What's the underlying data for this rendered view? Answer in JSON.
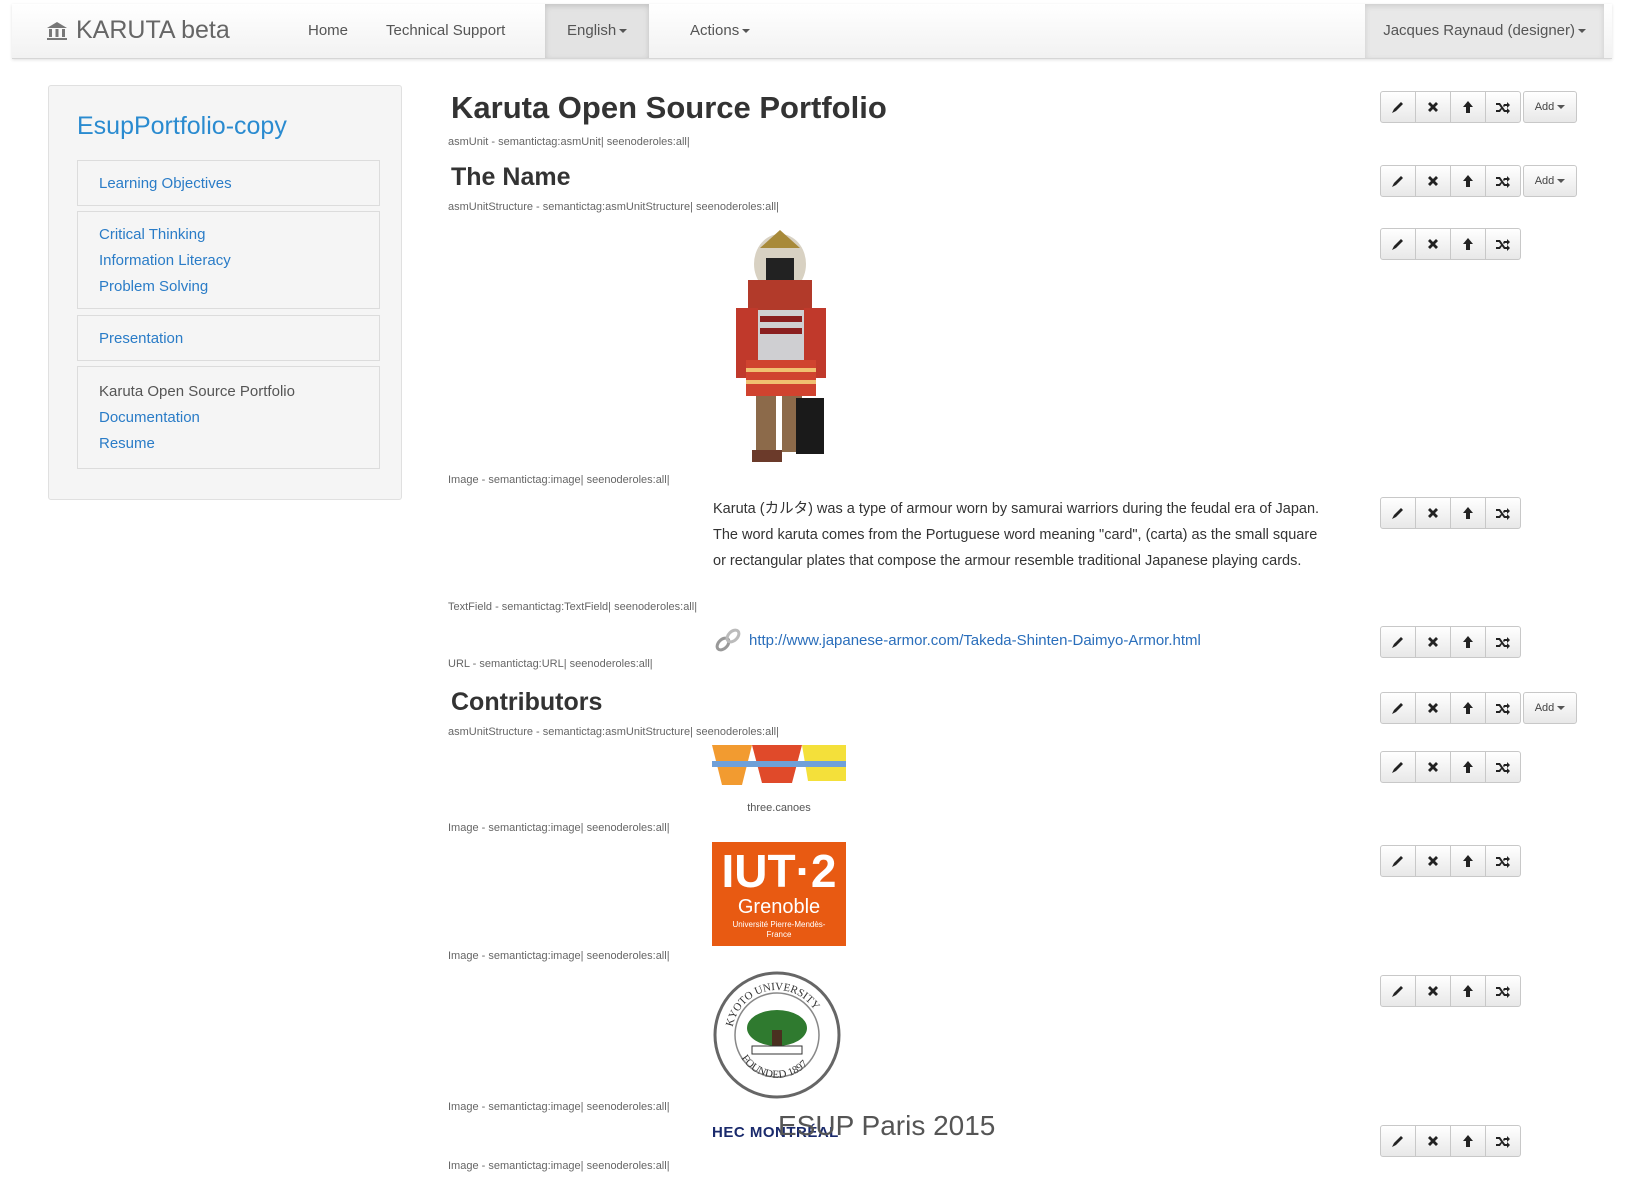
{
  "navbar": {
    "brand": "KARUTA beta",
    "items": [
      {
        "label": "Home"
      },
      {
        "label": "Technical Support"
      },
      {
        "label": "English"
      },
      {
        "label": "Actions"
      }
    ],
    "user": "Jacques Raynaud (designer)"
  },
  "sidebar": {
    "title": "EsupPortfolio-copy",
    "groups": [
      [
        "Learning Objectives"
      ],
      [
        "Critical Thinking",
        "Information Literacy",
        "Problem Solving"
      ],
      [
        "Presentation"
      ],
      [
        "Karuta Open Source Portfolio",
        "Documentation",
        "Resume"
      ]
    ]
  },
  "main": {
    "unit_title": "Karuta Open Source Portfolio",
    "unit_meta": "asmUnit - semantictag:asmUnit| seenoderoles:all|",
    "section1_title": "The Name",
    "section1_meta": "asmUnitStructure - semantictag:asmUnitStructure| seenoderoles:all|",
    "image_meta": "Image - semantictag:image| seenoderoles:all|",
    "text_body": "Karuta (カルタ) was a type of armour worn by samurai warriors during the feudal era of Japan. The word karuta comes from the Portuguese word meaning \"card\", (carta) as the small square or rectangular plates that compose the armour resemble traditional Japanese playing cards.",
    "text_meta": "TextField - semantictag:TextField| seenoderoles:all|",
    "url": "http://www.japanese-armor.com/Takeda-Shinten-Daimyo-Armor.html",
    "url_meta": "URL - semantictag:URL| seenoderoles:all|",
    "section2_title": "Contributors",
    "section2_meta": "asmUnitStructure - semantictag:asmUnitStructure| seenoderoles:all|",
    "logo1_caption": "three.canoes",
    "logo2_line1": "IUT·2",
    "logo2_line2": "Grenoble",
    "logo2_line3": "Université Pierre-Mendès-France",
    "logo3_text": "KYOTO UNIVERSITY FOUNDED 1897",
    "logo4_text": "HEC MONTRÉAL"
  },
  "toolbar": {
    "add_label": "Add"
  },
  "footer": "ESUP Paris 2015",
  "colors": {
    "link": "#2a7cc7",
    "iut_orange": "#e85a12"
  }
}
